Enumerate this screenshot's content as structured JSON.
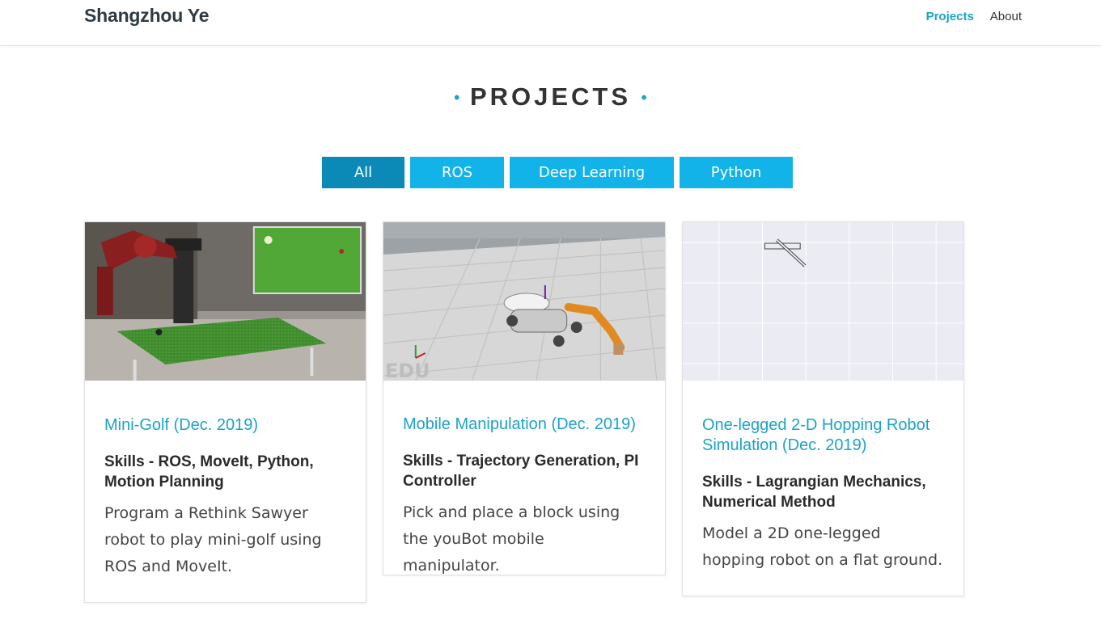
{
  "header": {
    "brand": "Shangzhou Ye",
    "nav": [
      {
        "label": "Projects",
        "active": true
      },
      {
        "label": "About",
        "active": false
      }
    ]
  },
  "section": {
    "dot": "•",
    "title": "PROJECTS"
  },
  "filters": [
    {
      "label": "All",
      "active": true
    },
    {
      "label": "ROS",
      "active": false
    },
    {
      "label": "Deep Learning",
      "active": false
    },
    {
      "label": "Python",
      "active": false
    }
  ],
  "projects": [
    {
      "title": "Mini-Golf (Dec. 2019)",
      "skills": "Skills - ROS, MoveIt, Python, Motion Planning",
      "description": "Program a Rethink Sawyer robot to play mini-golf using ROS and MoveIt.",
      "thumbnail": "robot-arm-minigolf-photo"
    },
    {
      "title": "Mobile Manipulation (Dec. 2019)",
      "skills": "Skills - Trajectory Generation, PI Controller",
      "description": "Pick and place a block using the youBot mobile manipulator.",
      "thumbnail": "youbot-simulation-render",
      "watermark": "EDU"
    },
    {
      "title": "One-legged 2-D Hopping Robot Simulation (Dec. 2019)",
      "skills": "Skills - Lagrangian Mechanics, Numerical Method",
      "description": "Model a 2D one-legged hopping robot on a flat ground.",
      "thumbnail": "hopping-robot-grid-plot"
    }
  ],
  "colors": {
    "accent": "#1aa3c9",
    "button": "#12b3e8",
    "button_active": "#0c8ab7"
  }
}
